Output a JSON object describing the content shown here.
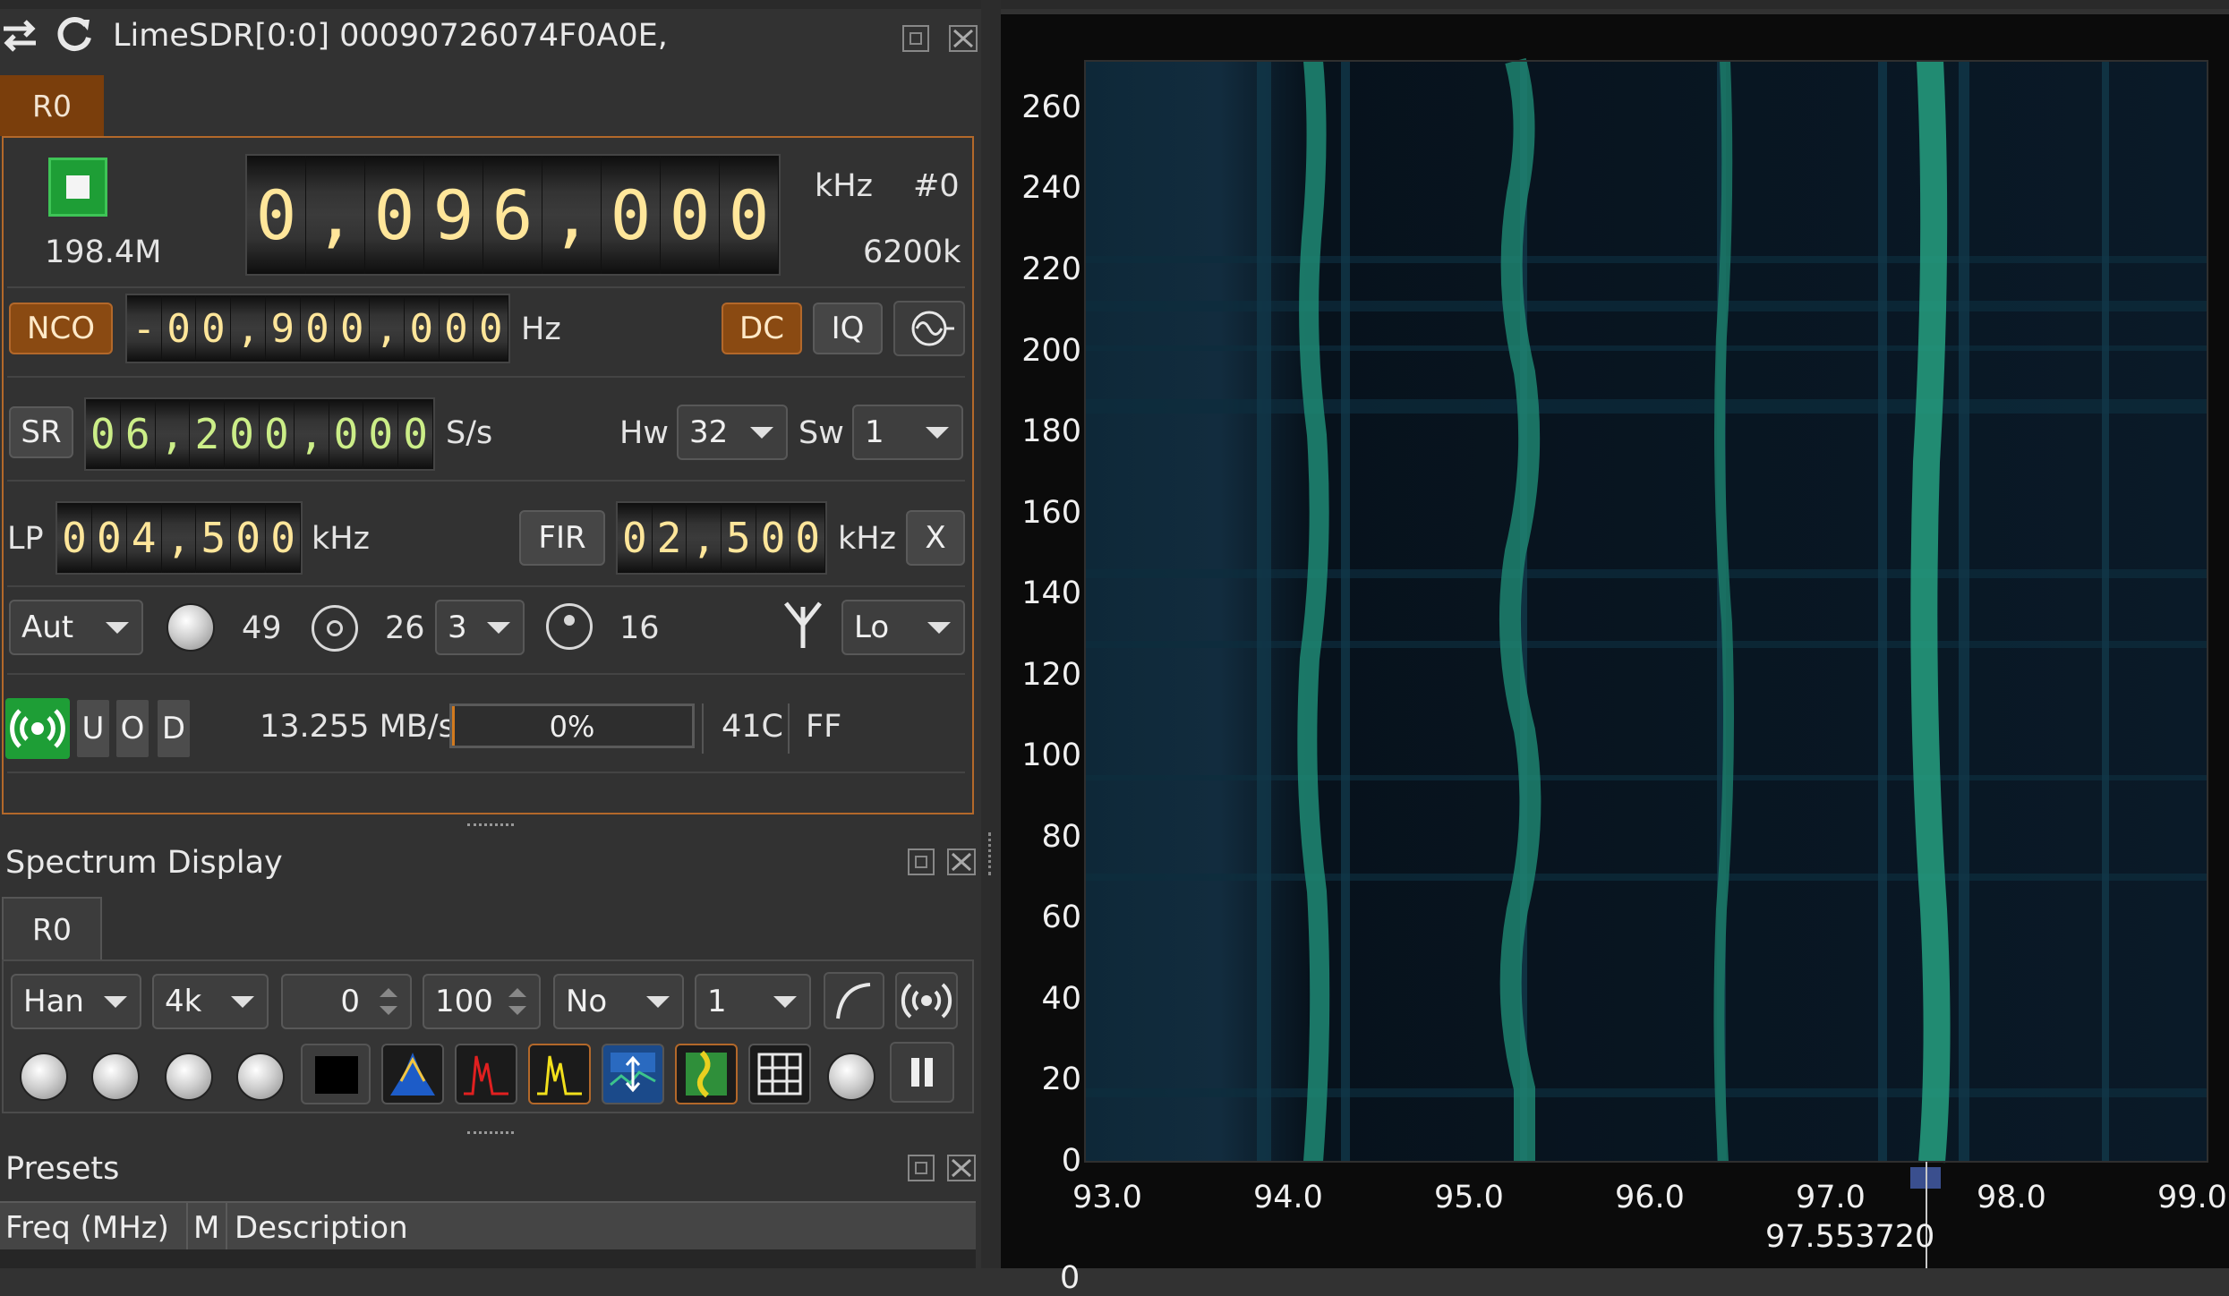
{
  "device": {
    "title": "LimeSDR[0:0] 00090726074F0A0E,",
    "tab": "R0",
    "center_freq_digits": "0,096,000",
    "center_freq_unit": "kHz",
    "device_set": "#0",
    "sample_rate_display": "198.4M",
    "bandwidth_display": "6200k",
    "nco_label": "NCO",
    "nco_digits": "-00,900,000",
    "nco_unit": "Hz",
    "dc_label": "DC",
    "iq_label": "IQ",
    "sr_label": "SR",
    "sr_digits": "06,200,000",
    "sr_unit": "S/s",
    "hw_label": "Hw",
    "hw_value": "32",
    "sw_label": "Sw",
    "sw_value": "1",
    "lp_label": "LP",
    "lp_digits": "004,500",
    "lp_unit": "kHz",
    "fir_label": "FIR",
    "fir_digits": "02,500",
    "fir_unit": "kHz",
    "fir_x": "X",
    "gain_mode": "Aut",
    "gain_value": "49",
    "lna_value": "26",
    "tia_value": "3",
    "pga_value": "16",
    "antenna": "Lo",
    "u_label": "U",
    "o_label": "O",
    "d_label": "D",
    "stream_rate": "13.255 MB/s",
    "fifo_percent": "0%",
    "fifo_fill": 0,
    "temperature": "41C",
    "gpio": "FF",
    "colors": {
      "accent": "#b3682a",
      "tab_bg": "#7a3e0c",
      "run_green": "#22a83a",
      "digit_yellow": "#ffe69a",
      "digit_green": "#ccee88"
    }
  },
  "spectrum": {
    "title": "Spectrum Display",
    "tab": "R0",
    "window": "Han",
    "fft_size": "4k",
    "ref_level": "0",
    "range": "100",
    "averaging": "No",
    "avg_count": "1"
  },
  "presets": {
    "title": "Presets",
    "columns": [
      "Freq (MHz)",
      "M",
      "Description"
    ]
  },
  "waterfall": {
    "y_ticks": [
      "260",
      "240",
      "220",
      "200",
      "180",
      "160",
      "140",
      "120",
      "100",
      "80",
      "60",
      "40",
      "20",
      "0"
    ],
    "x_ticks": [
      "93.0",
      "94.0",
      "95.0",
      "96.0",
      "97.0",
      "98.0",
      "99.0"
    ],
    "marker_freq": "97.553720",
    "bottom_label": "0"
  }
}
